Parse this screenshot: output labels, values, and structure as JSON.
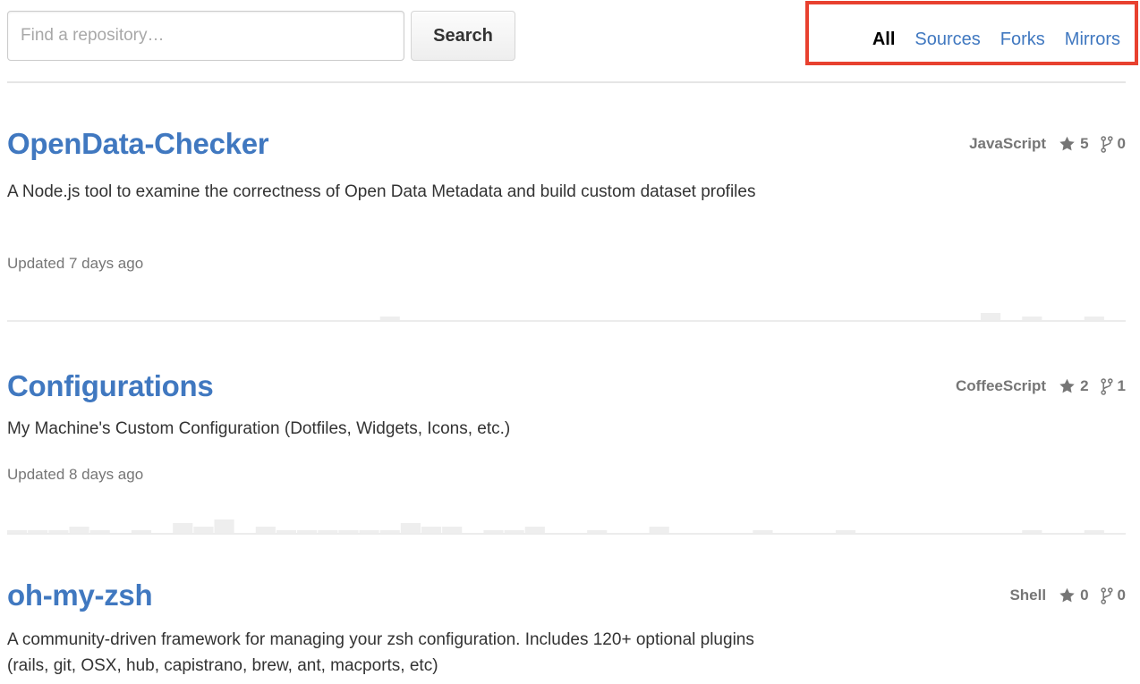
{
  "search": {
    "placeholder": "Find a repository…",
    "button_label": "Search"
  },
  "filters": [
    {
      "label": "All",
      "selected": true
    },
    {
      "label": "Sources",
      "selected": false
    },
    {
      "label": "Forks",
      "selected": false
    },
    {
      "label": "Mirrors",
      "selected": false
    }
  ],
  "colors": {
    "link": "#4078c0",
    "highlight_border": "#e8412f",
    "muted": "#767676",
    "activity": "#eeeeee"
  },
  "repos": [
    {
      "name": "OpenData-Checker",
      "description": "A Node.js tool to examine the correctness of Open Data Metadata and build custom dataset profiles",
      "updated": "Updated 7 days ago",
      "language": "JavaScript",
      "stars": "5",
      "forks": "0",
      "icons": [
        "star-icon",
        "fork-icon"
      ],
      "activity": [
        0,
        0,
        0,
        0,
        0,
        0,
        0,
        0,
        0,
        0,
        0,
        0,
        0,
        0,
        0,
        0,
        0,
        0,
        1,
        0,
        0,
        0,
        0,
        0,
        0,
        0,
        0,
        0,
        0,
        0,
        0,
        0,
        0,
        0,
        0,
        0,
        0,
        0,
        0,
        0,
        0,
        0,
        0,
        0,
        0,
        0,
        0,
        2,
        0,
        1,
        0,
        0,
        1,
        0
      ]
    },
    {
      "name": "Configurations",
      "description": "My Machine's Custom Configuration (Dotfiles, Widgets, Icons, etc.)",
      "updated": "Updated 8 days ago",
      "language": "CoffeeScript",
      "stars": "2",
      "forks": "1",
      "icons": [
        "star-icon",
        "fork-icon"
      ],
      "activity": [
        1,
        1,
        1,
        2,
        1,
        0,
        1,
        0,
        3,
        2,
        4,
        0,
        2,
        1,
        1,
        1,
        1,
        1,
        1,
        3,
        2,
        2,
        0,
        1,
        1,
        2,
        0,
        0,
        1,
        0,
        0,
        2,
        0,
        0,
        0,
        0,
        1,
        0,
        0,
        0,
        1,
        0,
        0,
        0,
        0,
        0,
        0,
        0,
        0,
        1,
        0,
        0,
        1,
        0
      ]
    },
    {
      "name": "oh-my-zsh",
      "description": "A community-driven framework for managing your zsh configuration. Includes 120+ optional plugins (rails, git, OSX, hub, capistrano, brew, ant, macports, etc)",
      "updated": "",
      "language": "Shell",
      "stars": "0",
      "forks": "0",
      "icons": [
        "star-icon",
        "fork-icon"
      ],
      "activity": []
    }
  ]
}
